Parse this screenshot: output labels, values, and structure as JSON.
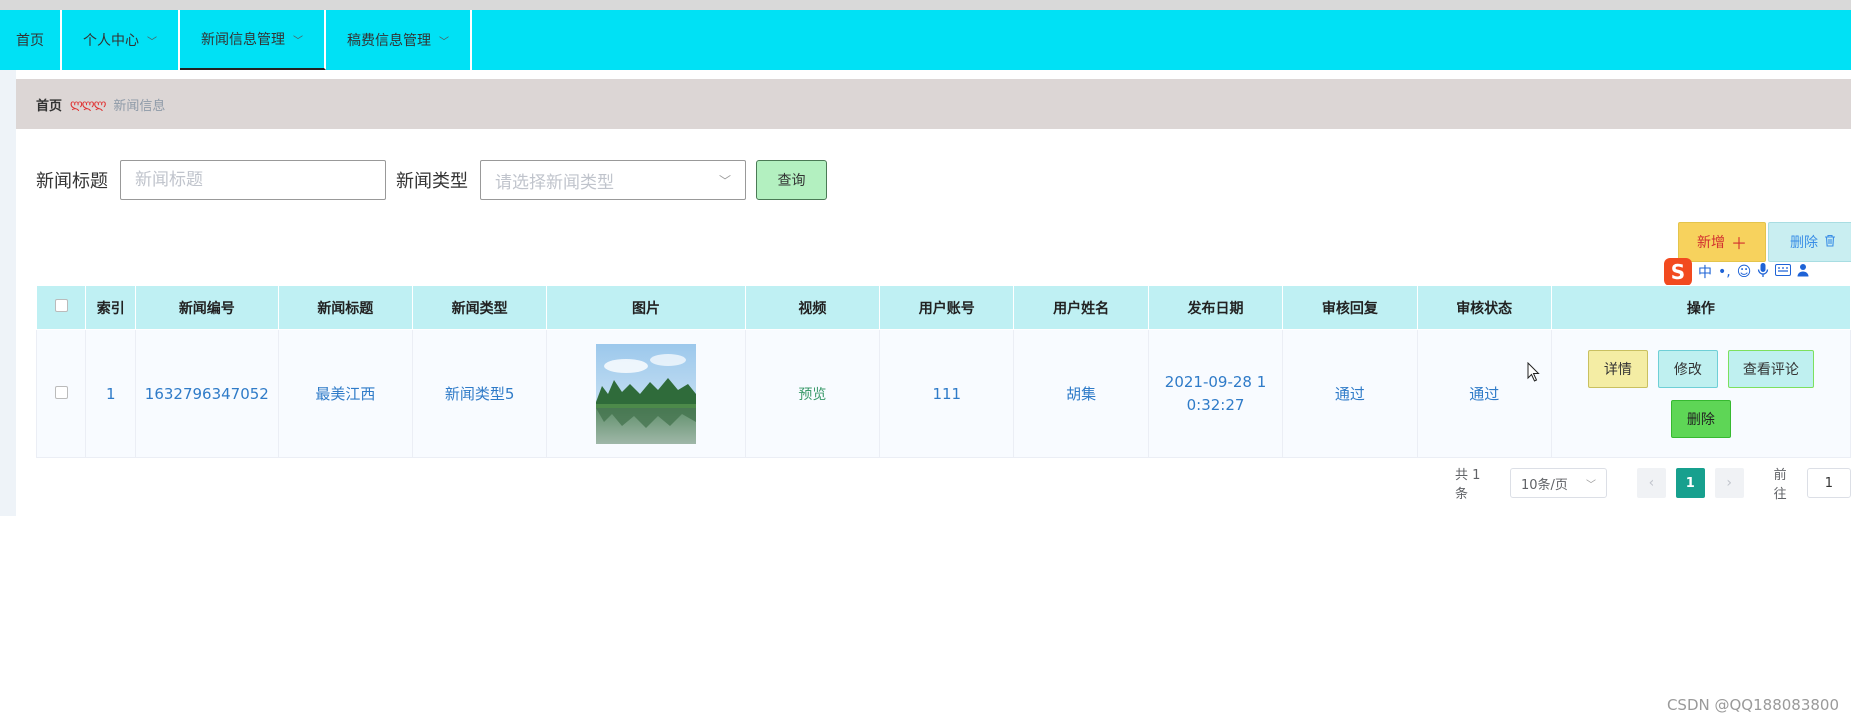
{
  "nav": {
    "items": [
      {
        "label": "首页",
        "has_dropdown": false,
        "active": false
      },
      {
        "label": "个人中心",
        "has_dropdown": true,
        "active": false
      },
      {
        "label": "新闻信息管理",
        "has_dropdown": true,
        "active": true
      },
      {
        "label": "稿费信息管理",
        "has_dropdown": true,
        "active": false
      }
    ]
  },
  "breadcrumb": {
    "home": "首页",
    "separator": "ლლლ",
    "current": "新闻信息"
  },
  "search": {
    "title_label": "新闻标题",
    "title_placeholder": "新闻标题",
    "type_label": "新闻类型",
    "type_placeholder": "请选择新闻类型",
    "query_button": "查询"
  },
  "actions": {
    "add_label": "新增",
    "add_icon": "plus-icon",
    "delete_label": "删除",
    "delete_icon": "trash-icon"
  },
  "ime": {
    "logo": "S",
    "mode": "中"
  },
  "table": {
    "headers": [
      "索引",
      "新闻编号",
      "新闻标题",
      "新闻类型",
      "图片",
      "视频",
      "用户账号",
      "用户姓名",
      "发布日期",
      "审核回复",
      "审核状态",
      "操作"
    ],
    "rows": [
      {
        "index": "1",
        "news_no": "1632796347052",
        "title": "最美江西",
        "type": "新闻类型5",
        "image": "landscape-thumbnail",
        "video": "预览",
        "account": "111",
        "name": "胡集",
        "date": "2021-09-28 10:32:27",
        "reply": "通过",
        "status": "通过"
      }
    ],
    "ops": {
      "detail": "详情",
      "edit": "修改",
      "comments": "查看评论",
      "delete": "删除"
    }
  },
  "pagination": {
    "total": "共 1 条",
    "page_size": "10条/页",
    "current_page": "1",
    "goto_label": "前往",
    "goto_value": "1"
  },
  "watermark": "CSDN @QQ188083800",
  "colors": {
    "navbar": "#00e1f5",
    "breadcrumb_bg": "#dcd6d5",
    "table_header": "#bff0f3",
    "active_page": "#17a08e",
    "add_button": "#f7d25d"
  }
}
